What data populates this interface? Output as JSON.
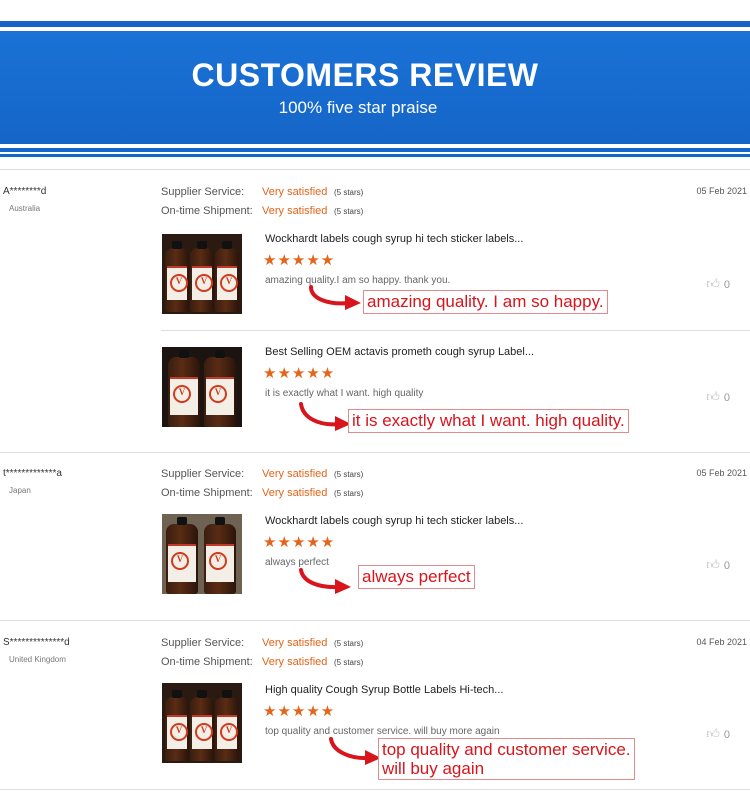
{
  "header": {
    "title": "CUSTOMERS REVIEW",
    "subtitle": "100% five star praise"
  },
  "labels": {
    "supplier_service": "Supplier Service:",
    "ontime_shipment": "On-time Shipment:"
  },
  "reviews": [
    {
      "name": "A********d",
      "country": "Australia",
      "date": "05 Feb 2021",
      "supplier_value": "Very satisfied",
      "supplier_stars": "(5 stars)",
      "shipment_value": "Very satisfied",
      "shipment_stars": "(5 stars)",
      "products": [
        {
          "title": "Wockhardt labels cough syrup hi tech sticker labels...",
          "stars": "★★★★★",
          "text": "amazing quality.I am so happy. thank you.",
          "callout": "amazing quality. I am so happy.",
          "likes": "0"
        },
        {
          "title": "Best Selling OEM actavis prometh cough syrup Label...",
          "stars": "★★★★★",
          "text": "it is exactly what I want. high quality",
          "callout": "it is exactly what I want. high quality.",
          "likes": "0"
        }
      ]
    },
    {
      "name": "t*************a",
      "country": "Japan",
      "date": "05 Feb 2021",
      "supplier_value": "Very satisfied",
      "supplier_stars": "(5 stars)",
      "shipment_value": "Very satisfied",
      "shipment_stars": "(5 stars)",
      "products": [
        {
          "title": "Wockhardt labels cough syrup hi tech sticker labels...",
          "stars": "★★★★★",
          "text": "always perfect",
          "callout": "always perfect",
          "likes": "0"
        }
      ]
    },
    {
      "name": "S**************d",
      "country": "United Kingdom",
      "date": "04 Feb 2021",
      "supplier_value": "Very satisfied",
      "supplier_stars": "(5 stars)",
      "shipment_value": "Very satisfied",
      "shipment_stars": "(5 stars)",
      "products": [
        {
          "title": "High quality Cough Syrup Bottle Labels Hi-tech...",
          "stars": "★★★★★",
          "text": "top quality and customer service. will buy more again",
          "callout_line1": "top quality and customer service.",
          "callout_line2": "will buy again",
          "likes": "0"
        }
      ]
    }
  ],
  "colors": {
    "banner_blue": "#1565c8",
    "accent_orange": "#e3641a",
    "callout_red": "#d8141c"
  },
  "icons": {
    "like": "thumbs-up-icon",
    "arrow": "curved-arrow-icon",
    "star": "star-icon"
  }
}
